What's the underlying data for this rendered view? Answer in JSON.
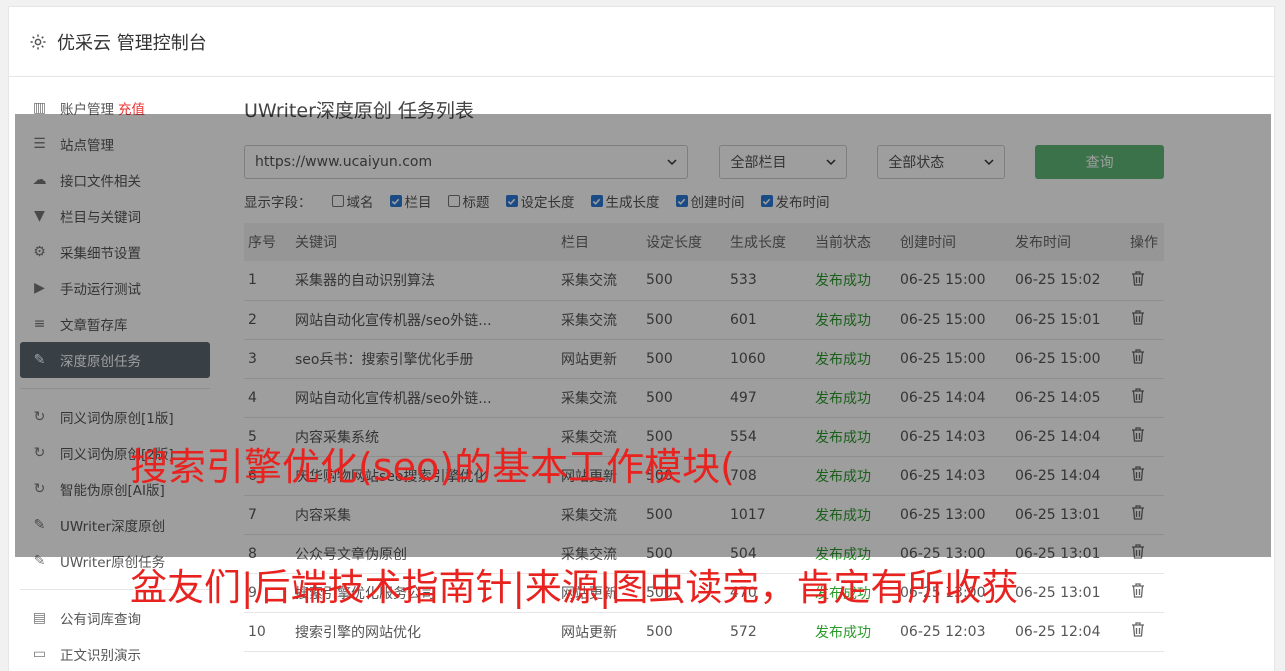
{
  "header": {
    "title": "优采云 管理控制台"
  },
  "sidebar": {
    "items": [
      {
        "label": "账户管理",
        "badge": "充值",
        "icon": "bar-chart-icon"
      },
      {
        "label": "站点管理",
        "icon": "server-icon"
      },
      {
        "label": "接口文件相关",
        "icon": "cloud-upload-icon"
      },
      {
        "label": "栏目与关键词",
        "icon": "filter-icon"
      },
      {
        "label": "采集细节设置",
        "icon": "gears-icon"
      },
      {
        "label": "手动运行测试",
        "icon": "play-circle-icon"
      },
      {
        "label": "文章暂存库",
        "icon": "database-icon"
      },
      {
        "label": "深度原创任务",
        "icon": "edit-icon"
      }
    ],
    "items2": [
      {
        "label": "同义词伪原创[1版]",
        "icon": "refresh-icon"
      },
      {
        "label": "同义词伪原创[2版]",
        "icon": "refresh-icon"
      },
      {
        "label": "智能伪原创[AI版]",
        "icon": "refresh-icon"
      },
      {
        "label": "UWriter深度原创",
        "icon": "edit-icon"
      },
      {
        "label": "UWriter原创任务",
        "icon": "edit-icon"
      }
    ],
    "items3": [
      {
        "label": "公有词库查询",
        "icon": "book-icon"
      },
      {
        "label": "正文识别演示",
        "icon": "monitor-icon"
      }
    ]
  },
  "main": {
    "title": "UWriter深度原创 任务列表",
    "site_select": "https://www.ucaiyun.com",
    "column_select": "全部栏目",
    "status_select": "全部状态",
    "query_label": "查询",
    "fields_label": "显示字段：",
    "fields": [
      {
        "label": "域名",
        "checked": false
      },
      {
        "label": "栏目",
        "checked": true
      },
      {
        "label": "标题",
        "checked": false
      },
      {
        "label": "设定长度",
        "checked": true
      },
      {
        "label": "生成长度",
        "checked": true
      },
      {
        "label": "创建时间",
        "checked": true
      },
      {
        "label": "发布时间",
        "checked": true
      }
    ],
    "columns": [
      "序号",
      "关键词",
      "栏目",
      "设定长度",
      "生成长度",
      "当前状态",
      "创建时间",
      "发布时间",
      "操作"
    ],
    "rows": [
      [
        "1",
        "采集器的自动识别算法",
        "采集交流",
        "500",
        "533",
        "发布成功",
        "06-25 15:00",
        "06-25 15:02"
      ],
      [
        "2",
        "网站自动化宣传机器/seo外链...",
        "采集交流",
        "500",
        "601",
        "发布成功",
        "06-25 15:00",
        "06-25 15:01"
      ],
      [
        "3",
        "seo兵书：搜索引擎优化手册",
        "网站更新",
        "500",
        "1060",
        "发布成功",
        "06-25 15:00",
        "06-25 15:00"
      ],
      [
        "4",
        "网站自动化宣传机器/seo外链...",
        "采集交流",
        "500",
        "497",
        "发布成功",
        "06-25 14:04",
        "06-25 14:05"
      ],
      [
        "5",
        "内容采集系统",
        "采集交流",
        "500",
        "554",
        "发布成功",
        "06-25 14:03",
        "06-25 14:04"
      ],
      [
        "6",
        "庆华购物网站seo搜索引擎优化",
        "网站更新",
        "500",
        "708",
        "发布成功",
        "06-25 14:03",
        "06-25 14:04"
      ],
      [
        "7",
        "内容采集",
        "采集交流",
        "500",
        "1017",
        "发布成功",
        "06-25 13:00",
        "06-25 13:01"
      ],
      [
        "8",
        "公众号文章伪原创",
        "采集交流",
        "500",
        "504",
        "发布成功",
        "06-25 13:00",
        "06-25 13:01"
      ],
      [
        "9",
        "搜索引擎优化服务公司",
        "网站更新",
        "500",
        "470",
        "发布成功",
        "06-25 13:00",
        "06-25 13:01"
      ],
      [
        "10",
        "搜索引擎的网站优化",
        "网站更新",
        "500",
        "572",
        "发布成功",
        "06-25 12:03",
        "06-25 12:04"
      ]
    ]
  },
  "banner": {
    "line1": "搜索引擎优化(seo)的基本工作模块(",
    "line2": "盆友们|后端技术指南针|来源|图虫读完，肯定有所收获"
  },
  "colors": {
    "active_bg": "#5b6770",
    "query_btn": "#5fb878",
    "success": "#2a9a2a",
    "banner": "#e8231f"
  }
}
